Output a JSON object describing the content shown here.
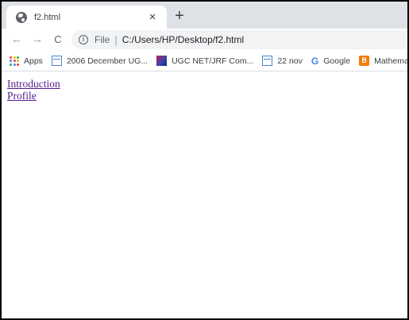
{
  "tab": {
    "title": "f2.html",
    "close_glyph": "×",
    "icon": "globe-icon"
  },
  "new_tab_glyph": "+",
  "toolbar": {
    "back_glyph": "←",
    "forward_glyph": "→",
    "reload_glyph": "C",
    "info_glyph": "i",
    "scheme": "File",
    "separator": "|",
    "url": "C:/Users/HP/Desktop/f2.html"
  },
  "bookmarks": {
    "apps": "Apps",
    "items": [
      {
        "label": "2006 December UG...",
        "icon": "doc-icon"
      },
      {
        "label": "UGC NET/JRF Com...",
        "icon": "ugc-icon"
      },
      {
        "label": "22 nov",
        "icon": "doc-icon"
      },
      {
        "label": "Google",
        "icon": "google-icon"
      },
      {
        "label": "Mathematics",
        "icon": "blogger-icon"
      }
    ]
  },
  "page": {
    "links": [
      {
        "label": "Introduction"
      },
      {
        "label": "Profile"
      }
    ]
  },
  "colors": {
    "visited_link": "#551a8b",
    "tabstrip": "#dee1e6",
    "omnibox": "#f1f3f4"
  }
}
